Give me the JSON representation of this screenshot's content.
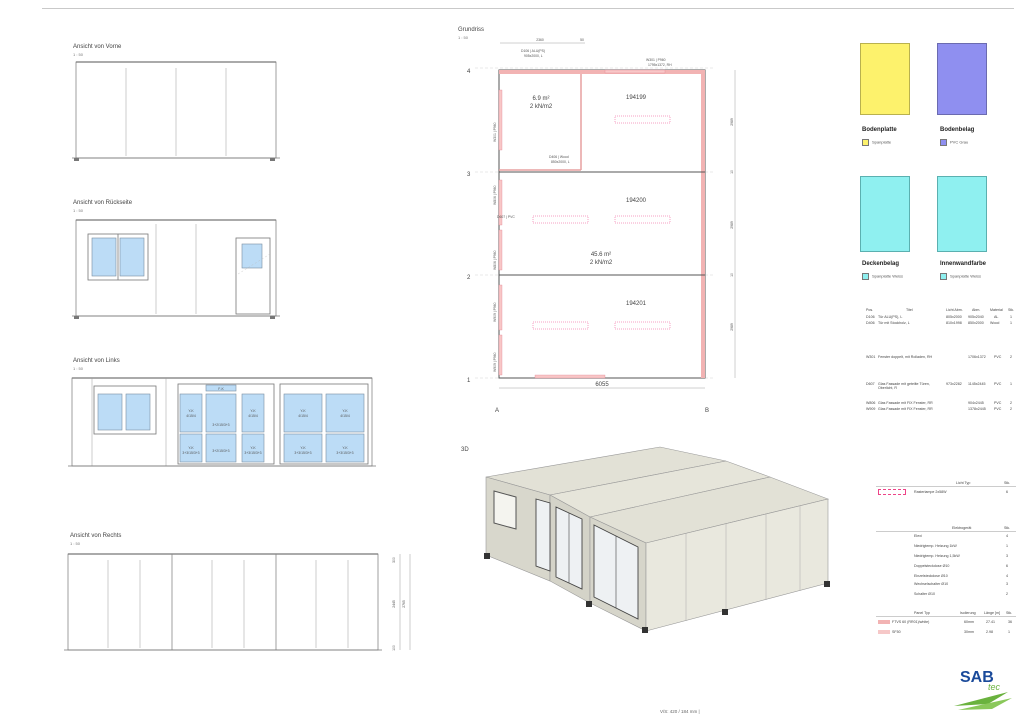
{
  "views": {
    "front": {
      "title": "Ansicht von Vorne",
      "scale": "1 : 50"
    },
    "back": {
      "title": "Ansicht von Rückseite",
      "scale": "1 : 50"
    },
    "left": {
      "title": "Ansicht von Links",
      "scale": "1 : 50"
    },
    "right": {
      "title": "Ansicht von Rechts",
      "scale": "1 : 50"
    }
  },
  "left_glass_labels": [
    "F-K",
    "Y-K\n4/15/4",
    "Y-K\n4/15/4",
    "3+2/15/3+3",
    "Y-K\n4/15/4",
    "Y-K\n4/15/4",
    "Y-K\n3+3/15/3+3",
    "3+2/15/3+3",
    "Y-K\n3+3/15/3+3",
    "Y-K\n3+3/15/3+3",
    "Y-K\n3+3/15/3+3"
  ],
  "right_dims": [
    "300",
    "2445",
    "2765",
    "100"
  ],
  "plan": {
    "title": "Grundriss",
    "scale": "1 : 50",
    "rows": [
      "4",
      "3",
      "2",
      "1"
    ],
    "cols": [
      "A",
      "B"
    ],
    "top_dims": [
      "2360",
      "50"
    ],
    "bottom_dim": "6055",
    "right_dims": [
      "2989",
      "10",
      "2989",
      "10",
      "2989"
    ],
    "rooms": [
      {
        "id": "194199",
        "area": "",
        "load": ""
      },
      {
        "id": "194200",
        "area": "",
        "load": ""
      },
      {
        "id": "194201",
        "area": "",
        "load": ""
      }
    ],
    "small_room": {
      "area": "6.9 m²",
      "load": "2 kN/m2"
    },
    "big_area": {
      "area": "45.6 m²",
      "load": "2 kN/m2"
    },
    "tags": {
      "d106": "D106 | ALU(PS)",
      "d106_sub": "905x2000, L\nPZ Lock",
      "w301_top": "W301 | P960",
      "w301_top_sub": "1795x1372, RH",
      "w301_left": "W301 | P960",
      "w301_left_sub": "1795x1372, RH",
      "d406": "D406 | Wood",
      "d406_sub": "850x2000, L\nPZ Lock",
      "w806a": "W806 | P960",
      "w806a_sub": "904x2445\nWhite/White",
      "d607": "D607 | PVC",
      "d607_sub": "1145x2445, R\nWhite/White\nPZ Lock",
      "w806b": "W806 | P960",
      "w806b_sub": "904x2445\nWhite/White",
      "w909a": "W909 | P960",
      "w909a_sub": "1378x2445\nWhite/White",
      "w909b": "W909 | P960",
      "w909b_sub": "1378x2445\nWhite/White"
    }
  },
  "label_3d": "3D",
  "legend": {
    "bodenplatte": {
      "title": "Bodenplatte",
      "item": "Spanplatte",
      "color": "#fdf26c"
    },
    "bodenbelag": {
      "title": "Bodenbelag",
      "item": "PVC Grau",
      "color": "#8f8ff0"
    },
    "deckenbelag": {
      "title": "Deckenbelag",
      "item": "Spanplatte Weiss",
      "color": "#8ff0f0"
    },
    "innenwandfarbe": {
      "title": "Innenwandfarbe",
      "item": "Spanplatte Weiss",
      "color": "#8ff0f0"
    }
  },
  "door_table": {
    "headers": [
      "Pos.",
      "Titel",
      "Licht Abm.",
      "Abm.",
      "Material",
      "Stk."
    ],
    "rows": [
      [
        "D106",
        "Tür ALU(PS), L",
        "805x2000",
        "905x2040",
        "AL",
        "1"
      ],
      [
        "D406",
        "Tür mit Stockholz, L",
        "810x1998",
        "850x2000",
        "Wood",
        "1"
      ]
    ]
  },
  "window_table": {
    "rows": [
      [
        "W301",
        "Fenster doppelt, mit Rolladen, RH",
        "",
        "1706x1372",
        "PVC",
        "2"
      ],
      [
        "D607",
        "Glas Fassade mit geteilte Türen, Oberlicht, R",
        "973x2282",
        "1145x2445",
        "PVC",
        "1"
      ],
      [
        "W806",
        "Glas Fassade mit FIX Fenster, RR",
        "",
        "904x2445",
        "PVC",
        "2"
      ],
      [
        "W909",
        "Glas Fassade mit FIX Fenster, RR",
        "",
        "1378x2445",
        "PVC",
        "2"
      ]
    ]
  },
  "light_table": {
    "headers": [
      "Licht Typ",
      "Stk."
    ],
    "rows": [
      [
        "Rasterlampe 2x58W",
        "6"
      ]
    ]
  },
  "elec_table": {
    "headers": [
      "Elektrogerät",
      "Stk."
    ],
    "rows": [
      [
        "Elexi",
        "4"
      ],
      [
        "Niedrigtemp. Heizung 1kW",
        "1"
      ],
      [
        "Niedrigtemp. Heizung 1,5kW",
        "3"
      ],
      [
        "Doppelsteckdose Ø10",
        "6"
      ],
      [
        "Einzelsteckdose Ø10",
        "4"
      ],
      [
        "Wechselschalter Ø10",
        "3"
      ],
      [
        "Schalter Ø10",
        "2"
      ]
    ]
  },
  "panel_table": {
    "headers": [
      "Panel Typ",
      "Isolierung",
      "Länge [m]",
      "Stk."
    ],
    "rows": [
      [
        "FTVS 60 (RR01)/white)",
        "60mm",
        "27.41",
        "36"
      ],
      [
        "SF50",
        "30mm",
        "2.98",
        "1"
      ]
    ]
  },
  "footer": "V/S: 420 / 184 mm |",
  "logo": {
    "text1": "SAB",
    "text2": "tec"
  }
}
